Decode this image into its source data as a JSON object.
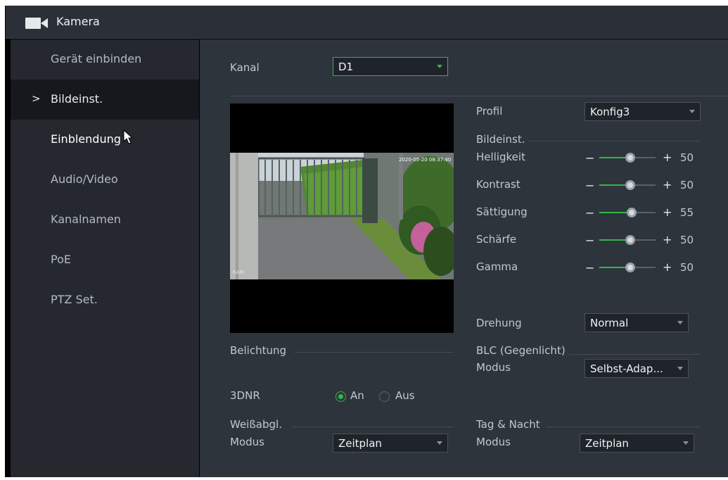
{
  "window": {
    "title": "Kamera",
    "icon": "camera-icon"
  },
  "sidebar": {
    "items": [
      {
        "label": "Gerät einbinden"
      },
      {
        "label": "Bildeinst.",
        "active": true,
        "chevron": ">"
      },
      {
        "label": "Einblendung"
      },
      {
        "label": "Audio/Video"
      },
      {
        "label": "Kanalnamen"
      },
      {
        "label": "PoE"
      },
      {
        "label": "PTZ Set."
      }
    ]
  },
  "channel": {
    "label": "Kanal",
    "value": "D1"
  },
  "preview": {
    "timestamp": "2020-05-20 08:37:40",
    "overlay_text": "KAM"
  },
  "image_settings": {
    "profile_label": "Profil",
    "profile_value": "Konfig3",
    "section_title": "Bildeinst.",
    "sliders": [
      {
        "label": "Helligkeit",
        "value": 50
      },
      {
        "label": "Kontrast",
        "value": 50
      },
      {
        "label": "Sättigung",
        "value": 55
      },
      {
        "label": "Schärfe",
        "value": 50
      },
      {
        "label": "Gamma",
        "value": 50
      }
    ],
    "minus": "−",
    "plus": "+"
  },
  "rotation": {
    "label": "Drehung",
    "value": "Normal"
  },
  "exposure": {
    "section_title": "Belichtung"
  },
  "blc": {
    "section_title": "BLC (Gegenlicht)",
    "mode_label": "Modus",
    "mode_value": "Selbst-Adap..."
  },
  "dnr": {
    "label": "3DNR",
    "on_label": "An",
    "off_label": "Aus",
    "selected": "An"
  },
  "white_balance": {
    "section_title": "Weißabgl.",
    "mode_label": "Modus",
    "mode_value": "Zeitplan"
  },
  "day_night": {
    "section_title": "Tag & Nacht",
    "mode_label": "Modus",
    "mode_value": "Zeitplan"
  },
  "colors": {
    "accent": "#33b54a",
    "panel": "#2e343c",
    "sidebar": "#25292f",
    "titlebar": "#2b3038"
  }
}
